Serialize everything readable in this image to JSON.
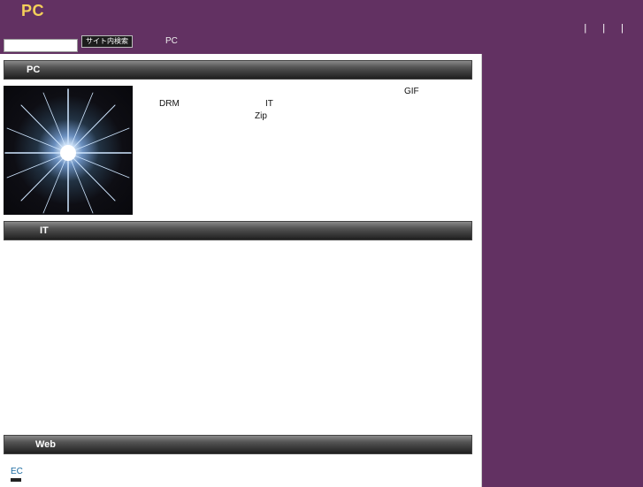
{
  "site": {
    "logo": "PC"
  },
  "top_nav": {
    "separators": [
      "|",
      "|",
      "|"
    ]
  },
  "search": {
    "value": "",
    "button_label": "サイト内検索"
  },
  "breadcrumb": "PC",
  "sections": [
    {
      "heading": "PC",
      "image_icon": "starburst-image",
      "text_words": [
        "GIF",
        "DRM",
        "IT",
        "Zip"
      ]
    },
    {
      "heading": "IT"
    },
    {
      "heading": "Web",
      "links": [
        "EC"
      ]
    }
  ],
  "colors": {
    "page_background": "#623162",
    "logo": "#f4d05a",
    "link": "#1a6aa0"
  }
}
